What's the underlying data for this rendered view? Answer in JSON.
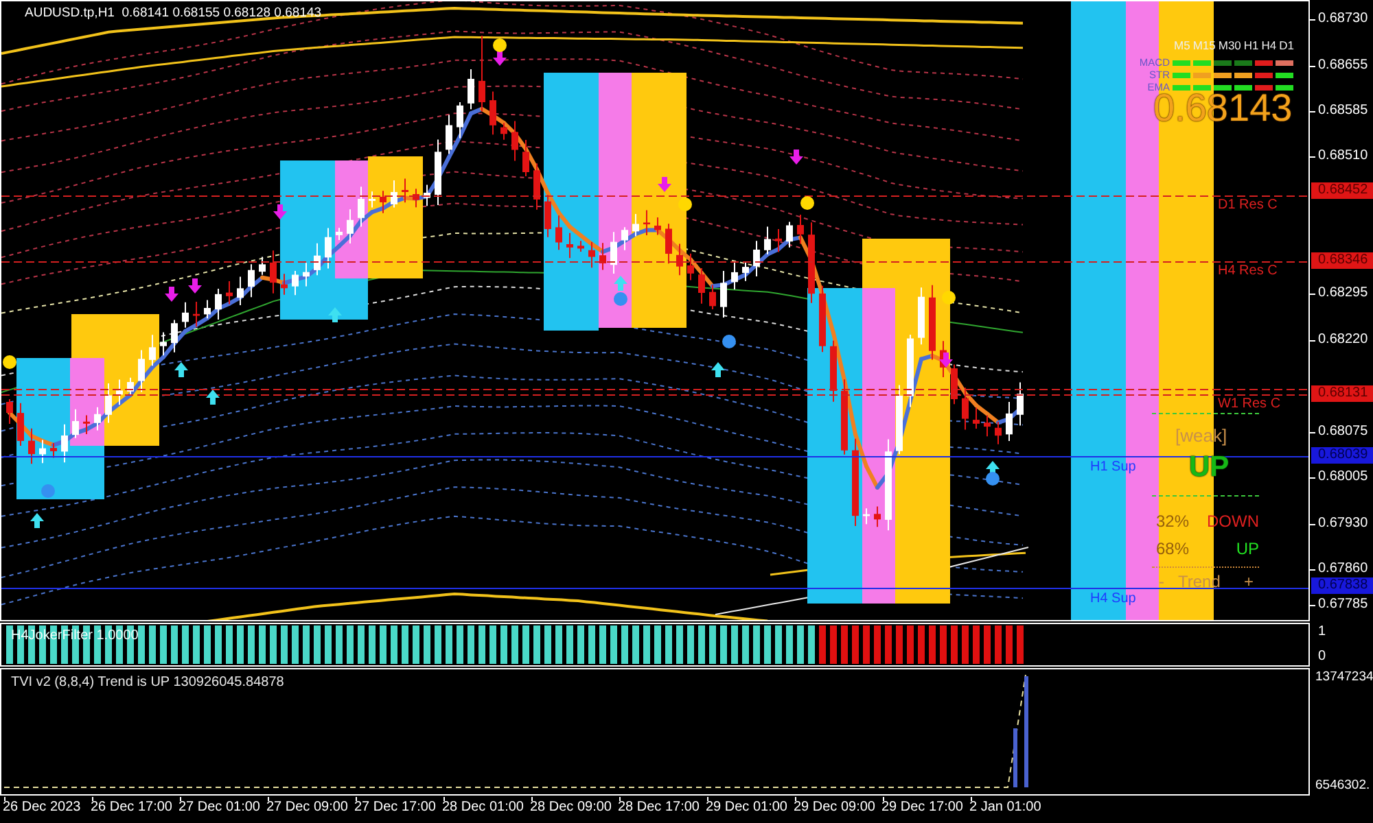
{
  "chart": {
    "title": "AUDUSD.tp,H1  0.68141 0.68155 0.68128 0.68143",
    "levels": [
      {
        "label": "D1 Res C",
        "price": "0.68452",
        "kind": "resistance"
      },
      {
        "label": "H4 Res C",
        "price": "0.68346",
        "kind": "resistance"
      },
      {
        "label": "W1 Res C",
        "price": "0.68131",
        "kind": "resistance"
      },
      {
        "label": "H1 Sup",
        "price": "0.68039",
        "kind": "support"
      },
      {
        "label": "H4 Sup",
        "price": "0.67838",
        "kind": "support"
      }
    ],
    "price_axis": [
      "0.68730",
      "0.68655",
      "0.68585",
      "0.68510",
      "0.68295",
      "0.68220",
      "0.68075",
      "0.68005",
      "0.67930",
      "0.67860",
      "0.67785"
    ]
  },
  "dashboard": {
    "timeframes": [
      "M5",
      "M15",
      "M30",
      "H1",
      "H4",
      "D1"
    ],
    "signals": [
      {
        "label": "MACD",
        "cells": [
          {
            "color": "#22dd22"
          },
          {
            "color": "#22dd22"
          },
          {
            "color": "#1a7a1a"
          },
          {
            "color": "#1a7a1a"
          },
          {
            "color": "#e01c1c"
          },
          {
            "color": "#e07060"
          }
        ]
      },
      {
        "label": "STR",
        "cells": [
          {
            "color": "#22dd22"
          },
          {
            "color": "#f0a020"
          },
          {
            "color": "#f0a020"
          },
          {
            "color": "#f0a020"
          },
          {
            "color": "#e01c1c"
          },
          {
            "color": "#22dd22"
          }
        ]
      },
      {
        "label": "EMA",
        "cells": [
          {
            "color": "#22dd22"
          },
          {
            "color": "#22dd22"
          },
          {
            "color": "#22dd22"
          },
          {
            "color": "#22dd22"
          },
          {
            "color": "#e01c1c"
          },
          {
            "color": "#22dd22"
          }
        ]
      }
    ],
    "price": "0.68143",
    "strength": "[weak]",
    "direction": {
      "label": "UP",
      "kind": "up"
    },
    "odds": [
      {
        "percent": "32%",
        "label": "DOWN",
        "kind": "down"
      },
      {
        "percent": "68%",
        "label": "UP",
        "kind": "up"
      }
    ],
    "trend": {
      "left": "-",
      "label": "Trend",
      "right": "+"
    }
  },
  "filter_pane": {
    "title": "H4JokerFilter 1.0000",
    "scale": [
      "1",
      "0"
    ]
  },
  "tvi_pane": {
    "title": "TVI v2 (8,8,4) Trend is UP 130926045.84878",
    "scale": [
      "13747234",
      "6546302."
    ]
  },
  "time_axis": [
    "26 Dec 2023",
    "26 Dec 17:00",
    "27 Dec 01:00",
    "27 Dec 09:00",
    "27 Dec 17:00",
    "28 Dec 01:00",
    "28 Dec 09:00",
    "28 Dec 17:00",
    "29 Dec 01:00",
    "29 Dec 09:00",
    "29 Dec 17:00",
    "2 Jan 01:00"
  ]
}
